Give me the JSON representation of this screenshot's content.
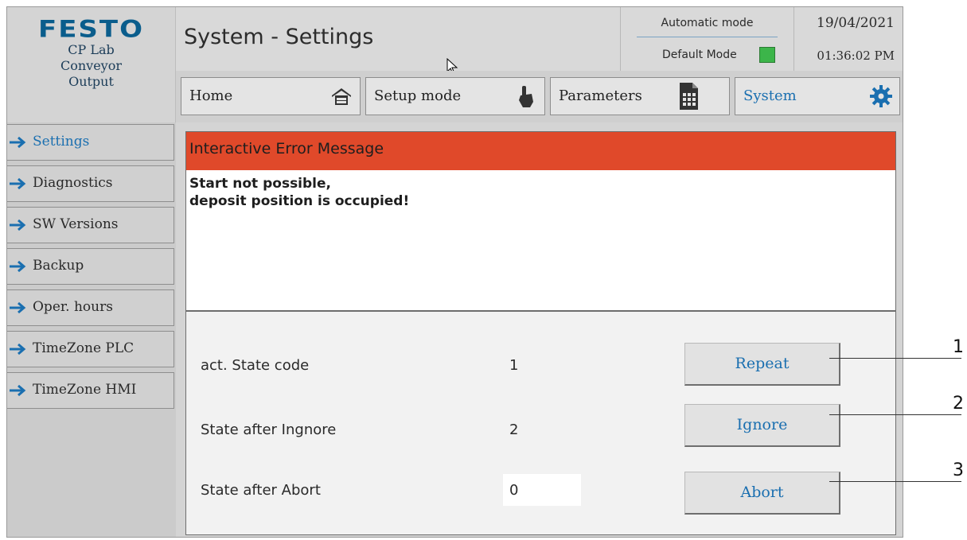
{
  "logo": {
    "brand": "FESTO",
    "lines": [
      "CP Lab",
      "Conveyor",
      "Output"
    ]
  },
  "header": {
    "title": "System - Settings",
    "mode_label": "Automatic mode",
    "submode_label": "Default Mode",
    "date": "19/04/2021",
    "time": "01:36:02 PM",
    "status_color": "#3cb54a"
  },
  "nav": {
    "items": [
      {
        "label": "Home",
        "icon": "home-icon"
      },
      {
        "label": "Setup mode",
        "icon": "hand-pointer-icon"
      },
      {
        "label": "Parameters",
        "icon": "document-grid-icon"
      },
      {
        "label": "System",
        "icon": "gear-icon"
      }
    ],
    "active": "System"
  },
  "sidebar": {
    "items": [
      {
        "label": "Settings"
      },
      {
        "label": "Diagnostics"
      },
      {
        "label": "SW Versions"
      },
      {
        "label": "Backup"
      },
      {
        "label": "Oper. hours"
      },
      {
        "label": "TimeZone PLC"
      },
      {
        "label": "TimeZone HMI"
      }
    ],
    "active": "Settings"
  },
  "error_dialog": {
    "title": "Interactive Error Message",
    "message_line1": "Start not possible,",
    "message_line2": "deposit position is occupied!",
    "header_color": "#e0492a"
  },
  "state": {
    "rows": [
      {
        "label": "act. State code",
        "value": "1"
      },
      {
        "label": "State after Ingnore",
        "value": "2"
      },
      {
        "label": "State after Abort",
        "value": "0"
      }
    ]
  },
  "actions": {
    "repeat_label": "Repeat",
    "ignore_label": "Ignore",
    "abort_label": "Abort"
  },
  "callouts": [
    "1",
    "2",
    "3"
  ]
}
